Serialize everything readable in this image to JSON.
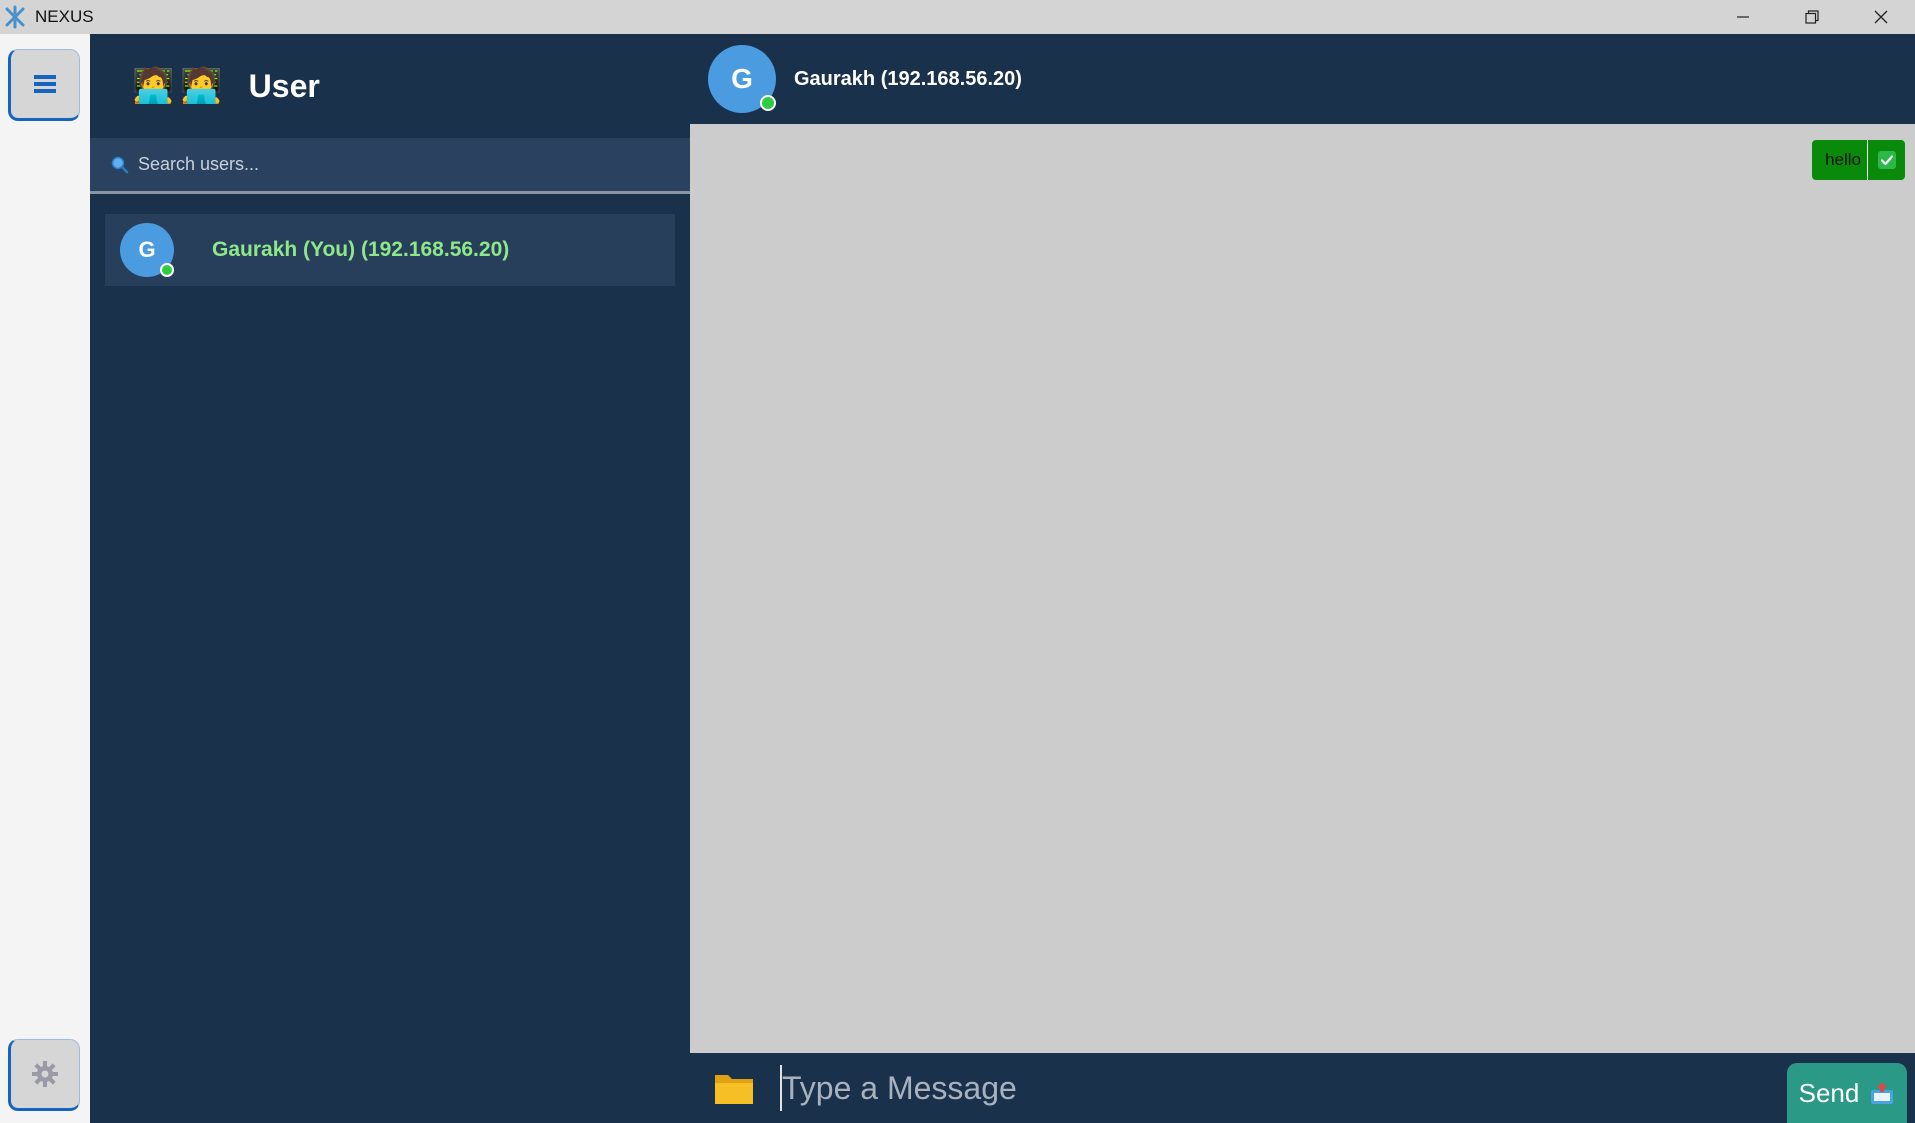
{
  "window": {
    "title": "NEXUS",
    "icon": "nexus-logo-icon",
    "controls": [
      "minimize-icon",
      "restore-icon",
      "close-icon"
    ]
  },
  "rail": {
    "menu_icon": "hamburger-menu-icon",
    "settings_icon": "gear-icon"
  },
  "sidebar": {
    "header_emoji": "🧑‍💻🧑‍💻",
    "title": "User",
    "search": {
      "placeholder": "Search users..."
    },
    "users": [
      {
        "avatar_letter": "G",
        "name": "Gaurakh (You) (192.168.56.20)",
        "online": true
      }
    ]
  },
  "chat": {
    "header": {
      "avatar_letter": "G",
      "title": "Gaurakh (192.168.56.20)",
      "online": true
    },
    "messages": [
      {
        "text": "hello",
        "status_icon": "check-icon",
        "direction": "outgoing"
      }
    ],
    "composer": {
      "attach_icon": "folder-icon",
      "placeholder": "Type a Message",
      "send_label": "Send",
      "send_icon": "outbox-icon"
    }
  },
  "colors": {
    "panel": "#1a314b",
    "chat_bg": "#cccccc",
    "accent_green_text": "#8ee88a",
    "bubble": "#0a8a0a",
    "send_button": "#2a9a86",
    "avatar": "#4b9be0",
    "online": "#2ecc40"
  }
}
